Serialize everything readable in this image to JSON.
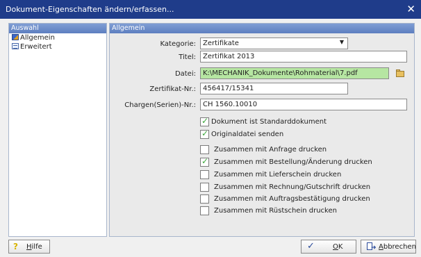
{
  "window": {
    "title": "Dokument-Eigenschaften ändern/erfassen...",
    "close_icon": "close-icon"
  },
  "sidebar": {
    "header": "Auswahl",
    "items": [
      {
        "label": "Allgemein",
        "icon": "properties-icon"
      },
      {
        "label": "Erweitert",
        "icon": "list-icon"
      }
    ]
  },
  "main": {
    "header": "Allgemein",
    "fields": {
      "kategorie": {
        "label": "Kategorie:",
        "value": "Zertifikate"
      },
      "titel": {
        "label": "Titel:",
        "value": "Zertifikat 2013"
      },
      "datei": {
        "label": "Datei:",
        "value": "K:\\MECHANIK_Dokumente\\Rohmaterial\\7.pdf",
        "highlight_color": "#b6e6a2"
      },
      "zertifikat_nr": {
        "label": "Zertifikat-Nr.:",
        "value": "456417/15341"
      },
      "chargen_nr": {
        "label": "Chargen(Serien)-Nr.:",
        "value": "CH 1560.10010"
      }
    },
    "checkboxes": [
      {
        "label": "Dokument ist Standarddokument",
        "checked": true
      },
      {
        "label": "Originaldatei senden",
        "checked": true
      },
      {
        "label": "Zusammen mit Anfrage drucken",
        "checked": false
      },
      {
        "label": "Zusammen mit Bestellung/Änderung drucken",
        "checked": true
      },
      {
        "label": "Zusammen mit Lieferschein drucken",
        "checked": false
      },
      {
        "label": "Zusammen mit Rechnung/Gutschrift drucken",
        "checked": false
      },
      {
        "label": "Zusammen mit Auftragsbestätigung drucken",
        "checked": false
      },
      {
        "label": "Zusammen mit Rüstschein drucken",
        "checked": false
      }
    ]
  },
  "buttons": {
    "help": {
      "icon_glyph": "?",
      "underline": "H",
      "rest": "ilfe"
    },
    "ok": {
      "icon_glyph": "✓",
      "underline": "O",
      "rest": "K"
    },
    "cancel": {
      "underline": "A",
      "rest": "bbrechen"
    }
  },
  "colors": {
    "titlebar": "#1f3c8a",
    "panel_header": "#6a8bc8",
    "check": "#3aa83a"
  }
}
